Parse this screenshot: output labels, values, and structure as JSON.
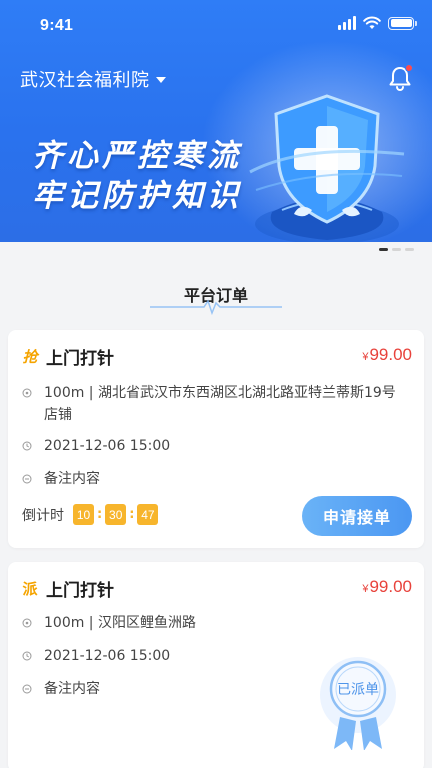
{
  "status_bar": {
    "time": "9:41"
  },
  "header": {
    "org_name": "武汉社会福利院"
  },
  "banner": {
    "line1": "齐心严控寒流",
    "line2": "牢记防护知识"
  },
  "section": {
    "title": "平台订单"
  },
  "orders": [
    {
      "badge": "抢",
      "title": "上门打针",
      "currency": "¥",
      "amount": "99.00",
      "address": "100m | 湖北省武汉市东西湖区北湖北路亚特兰蒂斯19号店铺",
      "time": "2021-12-06 15:00",
      "note": "备注内容",
      "countdown_label": "倒计时",
      "countdown": {
        "h": "10",
        "m": "30",
        "s": "47"
      },
      "action": "申请接单"
    },
    {
      "badge": "派",
      "title": "上门打针",
      "currency": "¥",
      "amount": "99.00",
      "address": "100m | 汉阳区鲤鱼洲路",
      "time": "2021-12-06 15:00",
      "note": "备注内容",
      "stamp": "已派单"
    }
  ],
  "colors": {
    "primary": "#2f7df6",
    "price": "#e8423b",
    "countdown": "#f7b52c",
    "button": "#4b97f2"
  },
  "icons": [
    "signal-icon",
    "wifi-icon",
    "battery-icon",
    "bell-icon",
    "location-icon",
    "clock-icon",
    "note-icon"
  ]
}
